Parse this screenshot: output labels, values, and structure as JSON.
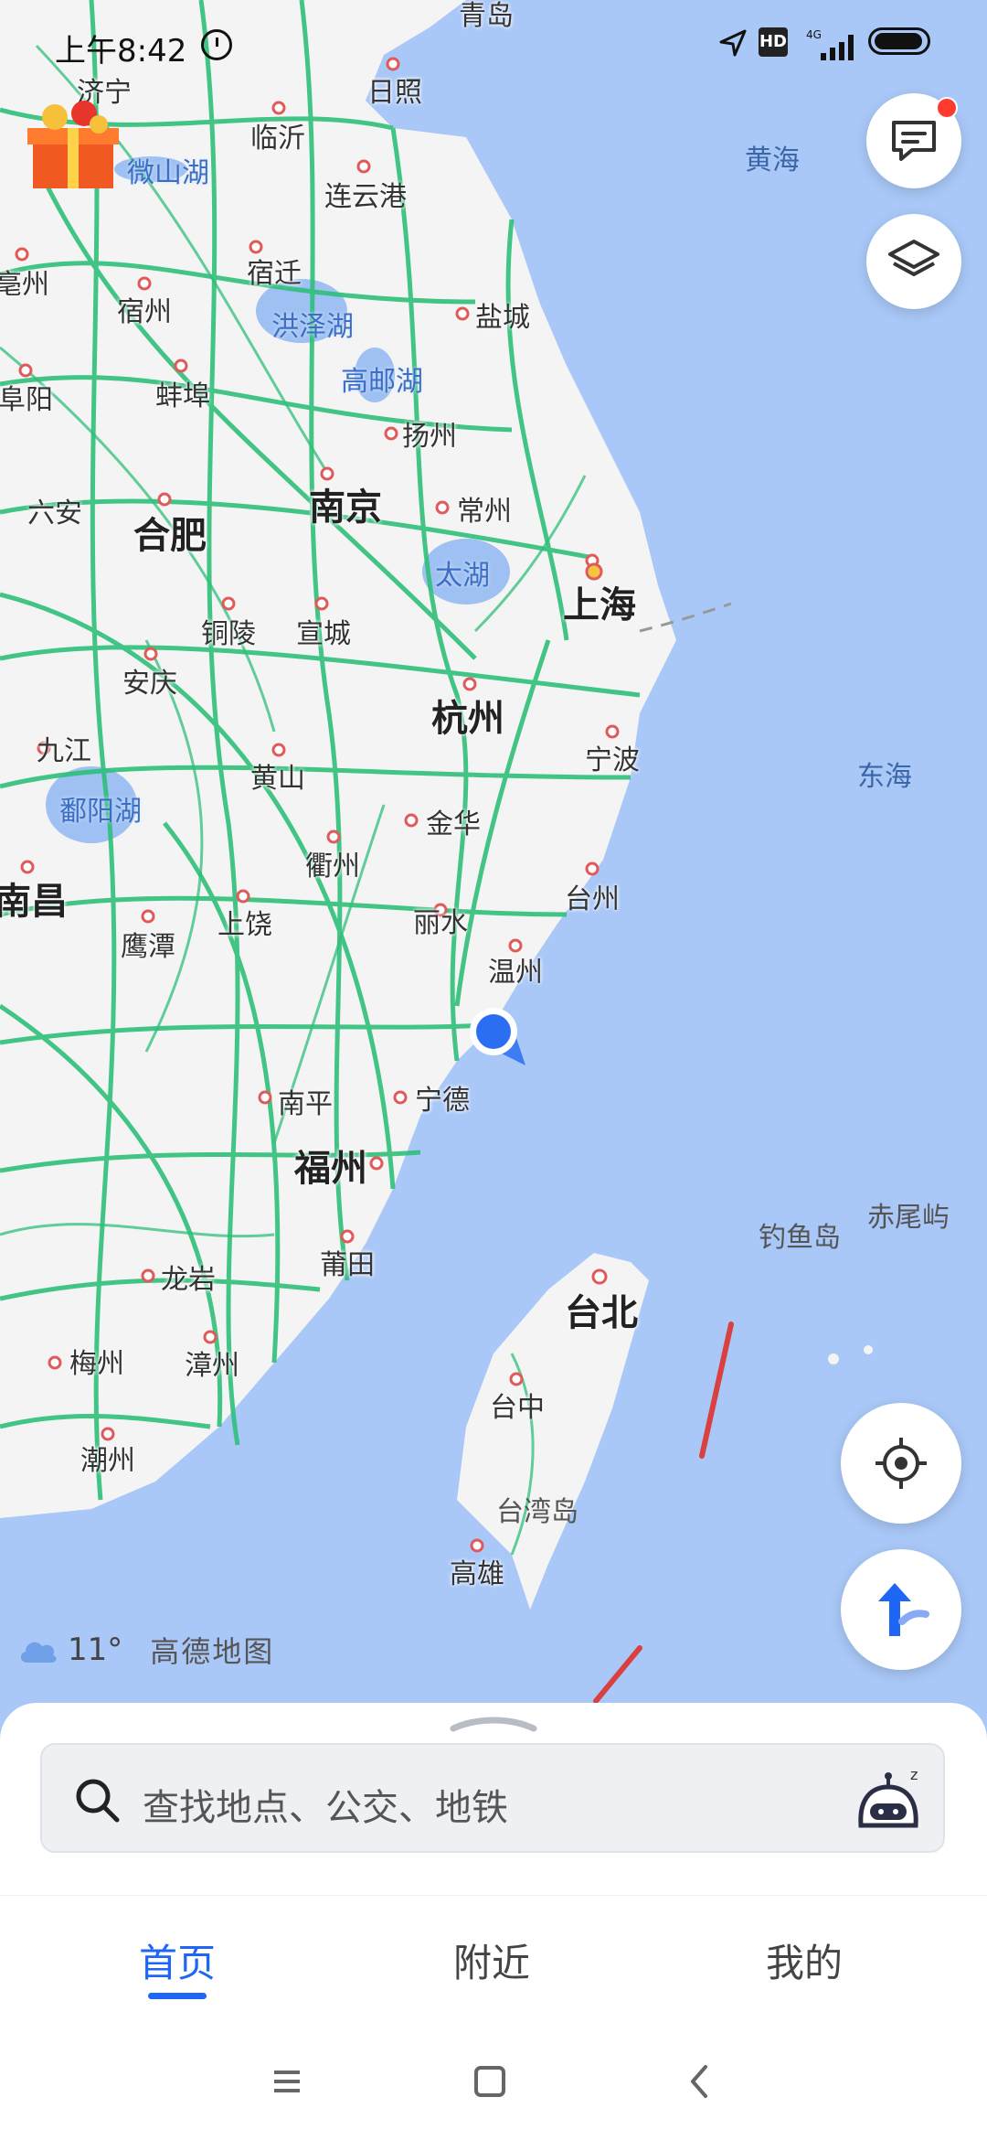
{
  "status_bar": {
    "time": "上午8:42",
    "icons": [
      "alarm-icon",
      "location-arrow-icon",
      "hd-icon",
      "signal-icon",
      "battery-icon"
    ],
    "network": "4G"
  },
  "map": {
    "seas": [
      "黄海",
      "东海"
    ],
    "lakes": [
      "微山湖",
      "洪泽湖",
      "高邮湖",
      "太湖",
      "鄱阳湖"
    ],
    "islands": [
      "钓鱼岛",
      "赤尾屿",
      "台湾岛"
    ],
    "major_cities": [
      "南京",
      "合肥",
      "上海",
      "杭州",
      "南昌",
      "福州",
      "台北"
    ],
    "cities": [
      "青岛",
      "济宁",
      "日照",
      "临沂",
      "连云港",
      "亳州",
      "宿州",
      "宿迁",
      "盐城",
      "阜阳",
      "蚌埠",
      "扬州",
      "六安",
      "常州",
      "铜陵",
      "宣城",
      "安庆",
      "九江",
      "黄山",
      "宁波",
      "金华",
      "衢州",
      "鹰潭",
      "上饶",
      "丽水",
      "台州",
      "温州",
      "宁德",
      "南平",
      "莆田",
      "龙岩",
      "梅州",
      "漳州",
      "潮州",
      "台中",
      "高雄"
    ]
  },
  "weather": {
    "temperature": "11°",
    "icon": "cloud-icon"
  },
  "brand": "高德地图",
  "search": {
    "placeholder": "查找地点、公交、地铁"
  },
  "tabs": [
    {
      "label": "首页",
      "active": true
    },
    {
      "label": "附近",
      "active": false
    },
    {
      "label": "我的",
      "active": false
    }
  ],
  "colors": {
    "accent": "#1e66f5",
    "sea": "#a9c8f7",
    "road": "#2fbf7a",
    "land": "#f4f4f4",
    "badge": "#ff3b30"
  }
}
